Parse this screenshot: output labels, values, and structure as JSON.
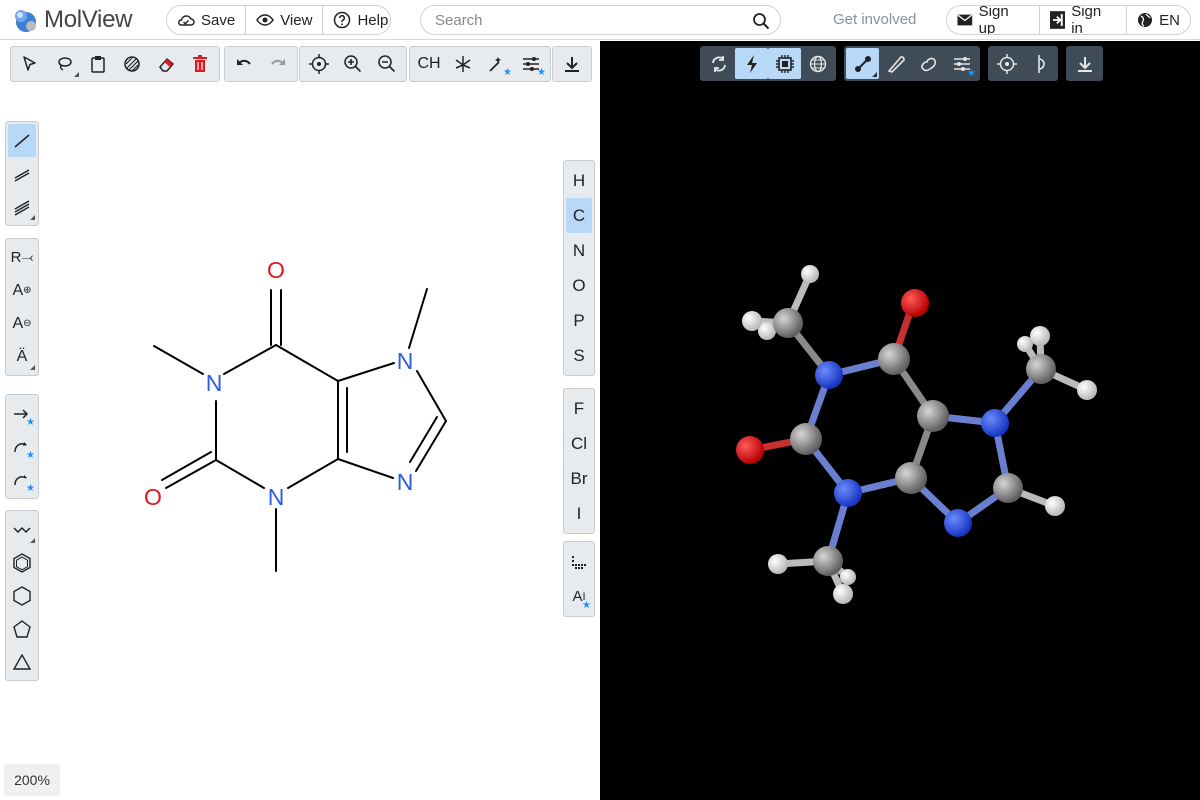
{
  "app": {
    "name": "MolView"
  },
  "header": {
    "save_label": "Save",
    "view_label": "View",
    "help_label": "Help",
    "search_placeholder": "Search",
    "get_involved": "Get involved",
    "signup_label": "Sign up",
    "signin_label": "Sign in",
    "language_label": "EN"
  },
  "sketcher": {
    "top_toolbar": {
      "ch_label": "CH"
    },
    "left_toolbar": {
      "r_group_label": "R",
      "charge_plus_label": "A",
      "charge_minus_label": "A",
      "radical_label": "Ä"
    },
    "elements": [
      "H",
      "C",
      "N",
      "O",
      "P",
      "S",
      "F",
      "Cl",
      "Br",
      "I"
    ],
    "active_element": "C",
    "zoom": "200%",
    "molecule_labels": {
      "o_top": "O",
      "o_left": "O",
      "n1": "N",
      "n3": "N",
      "n7": "N",
      "n9": "N"
    }
  },
  "colors": {
    "accent_active": "#b7d8f7",
    "nitrogen": "#2d5be3",
    "oxygen": "#e0191e",
    "bond": "#000000",
    "viewer_bg": "#000000"
  }
}
